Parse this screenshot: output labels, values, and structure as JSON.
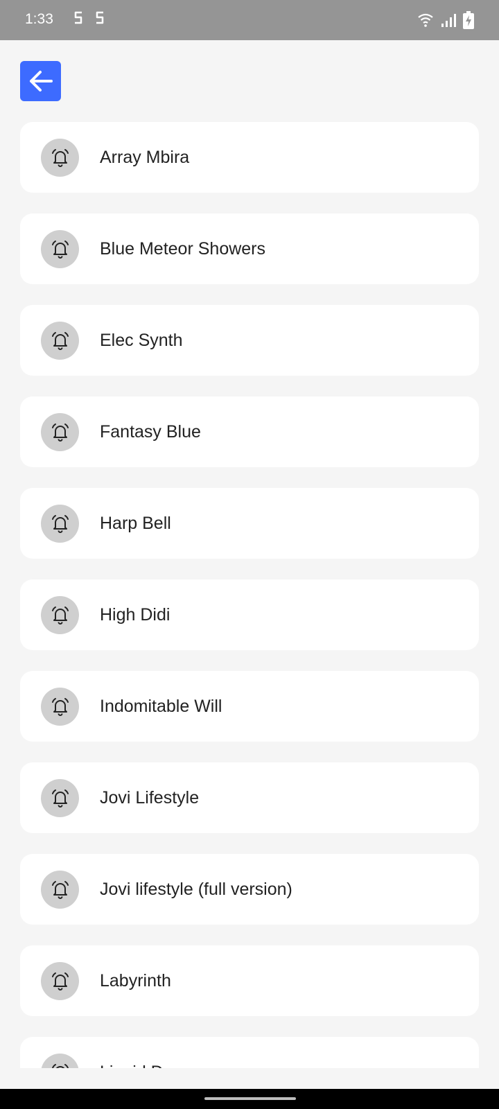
{
  "status_bar": {
    "time": "1:33",
    "left_icons": [
      "s-notification-icon",
      "s-notification-icon"
    ],
    "right_icons": [
      "wifi-icon",
      "signal-icon",
      "battery-charging-icon"
    ],
    "background": "#959595"
  },
  "header": {
    "back_icon": "arrow-left-icon",
    "back_button_color": "#3d6bff"
  },
  "ringtones": [
    {
      "label": "Array Mbira",
      "icon": "bell-icon"
    },
    {
      "label": "Blue Meteor Showers",
      "icon": "bell-icon"
    },
    {
      "label": "Elec Synth",
      "icon": "bell-icon"
    },
    {
      "label": "Fantasy Blue",
      "icon": "bell-icon"
    },
    {
      "label": "Harp Bell",
      "icon": "bell-icon"
    },
    {
      "label": "High Didi",
      "icon": "bell-icon"
    },
    {
      "label": "Indomitable Will",
      "icon": "bell-icon"
    },
    {
      "label": "Jovi Lifestyle",
      "icon": "bell-icon"
    },
    {
      "label": "Jovi lifestyle (full version)",
      "icon": "bell-icon"
    },
    {
      "label": "Labyrinth",
      "icon": "bell-icon"
    },
    {
      "label": "Liquid D",
      "icon": "bell-icon"
    }
  ]
}
